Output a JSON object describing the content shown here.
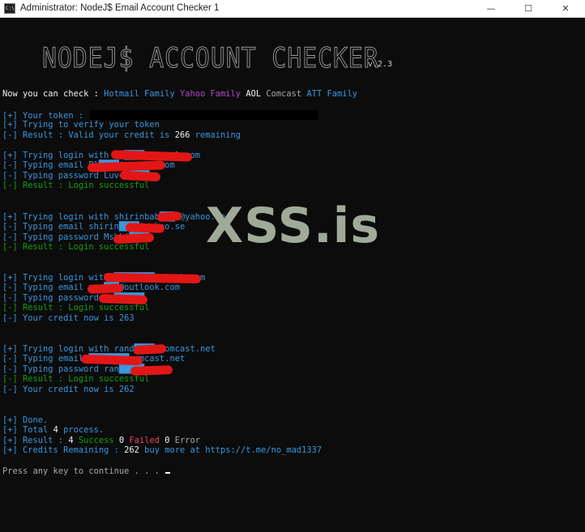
{
  "window": {
    "icon": "terminal-icon",
    "title": "Administrator:  NodeJ$ Email Account Checker 1",
    "buttons": {
      "minimize": "—",
      "maximize": "☐",
      "close": "✕"
    }
  },
  "banner": {
    "title": "NODEJ$ ACCOUNT CHECKER",
    "version": "v.2.3"
  },
  "support": {
    "prefix": "Now you can check : ",
    "providers": [
      "Hotmail Family",
      "Yahoo Family",
      "AOL",
      "Comcast",
      "ATT Family"
    ]
  },
  "token": {
    "l1": "[+] Your token : ",
    "l2": "[+] Trying to verify your token",
    "l3_prefix": "[-] Result : Valid your credit is ",
    "l3_credit": "266",
    "l3_suffix": " remaining"
  },
  "attempts": [
    {
      "login": "[+] Trying login with Bl████ine@aol.com",
      "email": "[-] Typing email Bl████ine@aol.com",
      "password": "[-] Typing password Luv4k████",
      "result": "[-] Result : Login successful",
      "credit": ""
    },
    {
      "login": "[+] Trying login with shirinbab███0@yahoo.se",
      "email": "[-] Typing email shirin████@yahoo.se",
      "password": "[-] Typing password Mshki████",
      "result": "[-] Result : Login successful",
      "credit": ""
    },
    {
      "login": "[+] Trying login with ████████utlook.com",
      "email": "[-] Typing email mer███@outlook.com",
      "password": "[-] Typing password Xm██████",
      "result": "[-] Result : Login successful",
      "credit": "[-] Your credit now is 263"
    },
    {
      "login": "[+] Trying login with rand████@comcast.net",
      "email": "[-] Typing email ████████comcast.net",
      "password": "[-] Typing password ran█████",
      "result": "[-] Result : Login successful",
      "credit": "[-] Your credit now is 262"
    }
  ],
  "summary": {
    "done": "[+] Done.",
    "total_prefix": "[+] Total ",
    "total_count": "4",
    "total_suffix": " process.",
    "result_prefix": "[+] Result : ",
    "success_count": "4",
    "success_label": " Success ",
    "failed_count": "0",
    "failed_label": " Failed ",
    "error_count": "0",
    "error_label": " Error",
    "credits_prefix": "[+] Credits Remaining : ",
    "credits_value": "262",
    "credits_mid": " buy more at ",
    "credits_link": "https://t.me/no_mad1337"
  },
  "prompt": "Press any key to continue . . . ",
  "watermark": "XSS.is",
  "colors": {
    "background": "#0c0c0c",
    "blue": "#3a96dd",
    "magenta": "#b148c6",
    "green": "#13a10e",
    "red": "#e74856",
    "yellow": "#f9f1a5",
    "redaction": "#e31616"
  }
}
